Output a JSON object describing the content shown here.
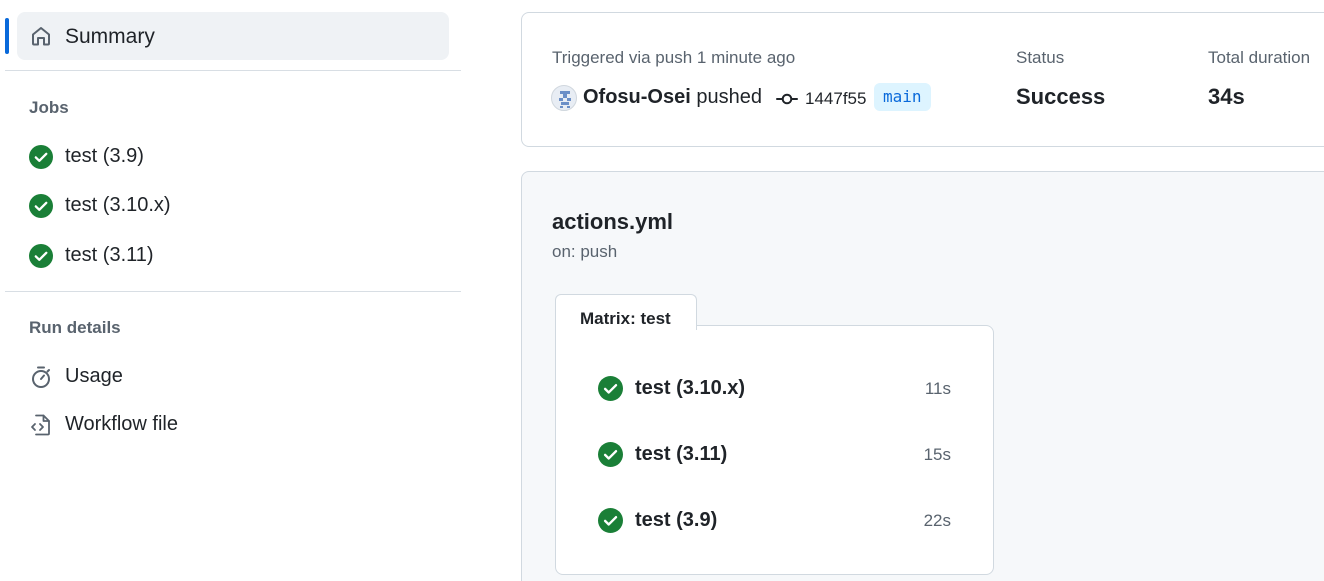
{
  "sidebar": {
    "summary_label": "Summary",
    "jobs_title": "Jobs",
    "jobs": [
      {
        "label": "test (3.9)",
        "status": "success"
      },
      {
        "label": "test (3.10.x)",
        "status": "success"
      },
      {
        "label": "test (3.11)",
        "status": "success"
      }
    ],
    "run_details_title": "Run details",
    "run_details": [
      {
        "label": "Usage",
        "icon": "stopwatch-icon"
      },
      {
        "label": "Workflow file",
        "icon": "file-code-icon"
      }
    ]
  },
  "run_summary": {
    "trigger_text": "Triggered via push 1 minute ago",
    "actor": "Ofosu-Osei",
    "action": "pushed",
    "commit_sha": "1447f55",
    "branch": "main",
    "status_label": "Status",
    "status_value": "Success",
    "duration_label": "Total duration",
    "duration_value": "34s"
  },
  "workflow": {
    "file_name": "actions.yml",
    "trigger": "on: push",
    "matrix_title": "Matrix: test",
    "jobs": [
      {
        "label": "test (3.10.x)",
        "duration": "11s"
      },
      {
        "label": "test (3.11)",
        "duration": "15s"
      },
      {
        "label": "test (3.9)",
        "duration": "22s"
      }
    ]
  },
  "colors": {
    "accent": "#0969da",
    "success": "#1a7f37",
    "border": "#d1d9e0",
    "muted_text": "#59636e"
  }
}
